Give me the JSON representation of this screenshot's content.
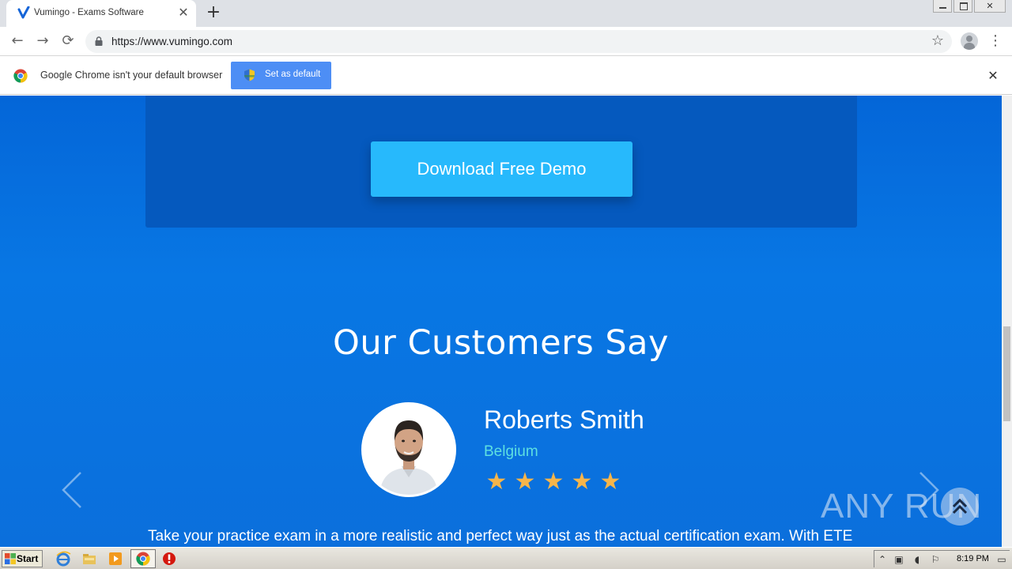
{
  "browser": {
    "tab": {
      "title": "Vumingo - Exams Software",
      "close": "✕"
    },
    "new_tab": "+",
    "url": "https://www.vumingo.com",
    "nav": {
      "back": "←",
      "forward": "→",
      "reload": "⟳"
    },
    "bookmark": "☆",
    "menu": "⋮"
  },
  "infobar": {
    "message": "Google Chrome isn't your default browser",
    "button_label": "Set as default",
    "close": "✕"
  },
  "page": {
    "demo_button": "Download Free Demo",
    "section_title": "Our Customers Say",
    "testimonial": {
      "name": "Roberts Smith",
      "country": "Belgium",
      "rating": 5,
      "star": "★",
      "quote": "Take your practice exam in a more realistic and perfect way just as the actual certification exam. With ETE"
    }
  },
  "watermark": "ANY RUN",
  "taskbar": {
    "start": "Start",
    "clock": "8:19 PM"
  },
  "colors": {
    "page_blue": "#0877e4",
    "demo_card": "#0559be",
    "demo_button": "#27b9fc",
    "country_text": "#5ee0e0",
    "star": "#f7b54a",
    "infobar_button": "#4d8ef5"
  }
}
